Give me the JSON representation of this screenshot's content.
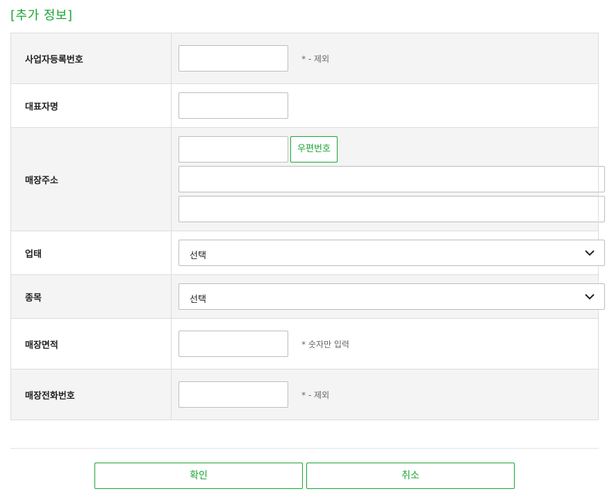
{
  "section": {
    "title": "[추가 정보]"
  },
  "fields": {
    "business_number": {
      "label": "사업자등록번호",
      "value": "",
      "hint": "* - 제외"
    },
    "representative": {
      "label": "대표자명",
      "value": ""
    },
    "store_address": {
      "label": "매장주소",
      "zipcode": "",
      "zip_button": "우편번호",
      "address1": "",
      "address2": ""
    },
    "business_type": {
      "label": "업태",
      "selected": "선택"
    },
    "business_item": {
      "label": "종목",
      "selected": "선택"
    },
    "store_area": {
      "label": "매장면적",
      "value": "",
      "hint": "* 숫자만 입력"
    },
    "store_phone": {
      "label": "매장전화번호",
      "value": "",
      "hint": "* - 제외"
    }
  },
  "actions": {
    "confirm": "확인",
    "cancel": "취소"
  },
  "icons": {
    "select_arrow": "chevron-down-icon"
  },
  "colors": {
    "accent": "#1aa532",
    "row_gray": "#f4f4f4",
    "border": "#dcdcdc"
  }
}
